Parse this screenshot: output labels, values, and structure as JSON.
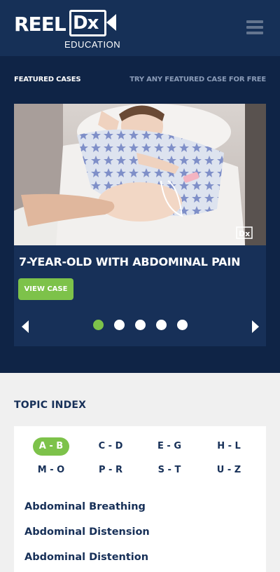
{
  "header": {
    "logo_reel": "REEL",
    "logo_dx": "Dx",
    "logo_education": "EDUCATION",
    "menu_icon": "hamburger-menu-icon"
  },
  "featured": {
    "title": "FEATURED CASES",
    "free_link": "TRY ANY FEATURED CASE FOR FREE",
    "case_title": "7-YEAR-OLD WITH ABDOMINAL PAIN",
    "view_button": "VIEW CASE",
    "image_watermark": "Dx",
    "slide_count": 5,
    "active_slide": 1
  },
  "topic_index": {
    "heading": "TOPIC INDEX",
    "letters": [
      "A - B",
      "C - D",
      "E - G",
      "H - L",
      "M - O",
      "P - R",
      "S - T",
      "U - Z"
    ],
    "active_letter": "A - B",
    "terms": [
      "Abdominal Breathing",
      "Abdominal Distension",
      "Abdominal Distention"
    ]
  },
  "colors": {
    "header_bg": "#163057",
    "featured_bg": "#0f2446",
    "card_bg": "#173058",
    "accent_green": "#7dc24a",
    "text_navy": "#173058"
  }
}
